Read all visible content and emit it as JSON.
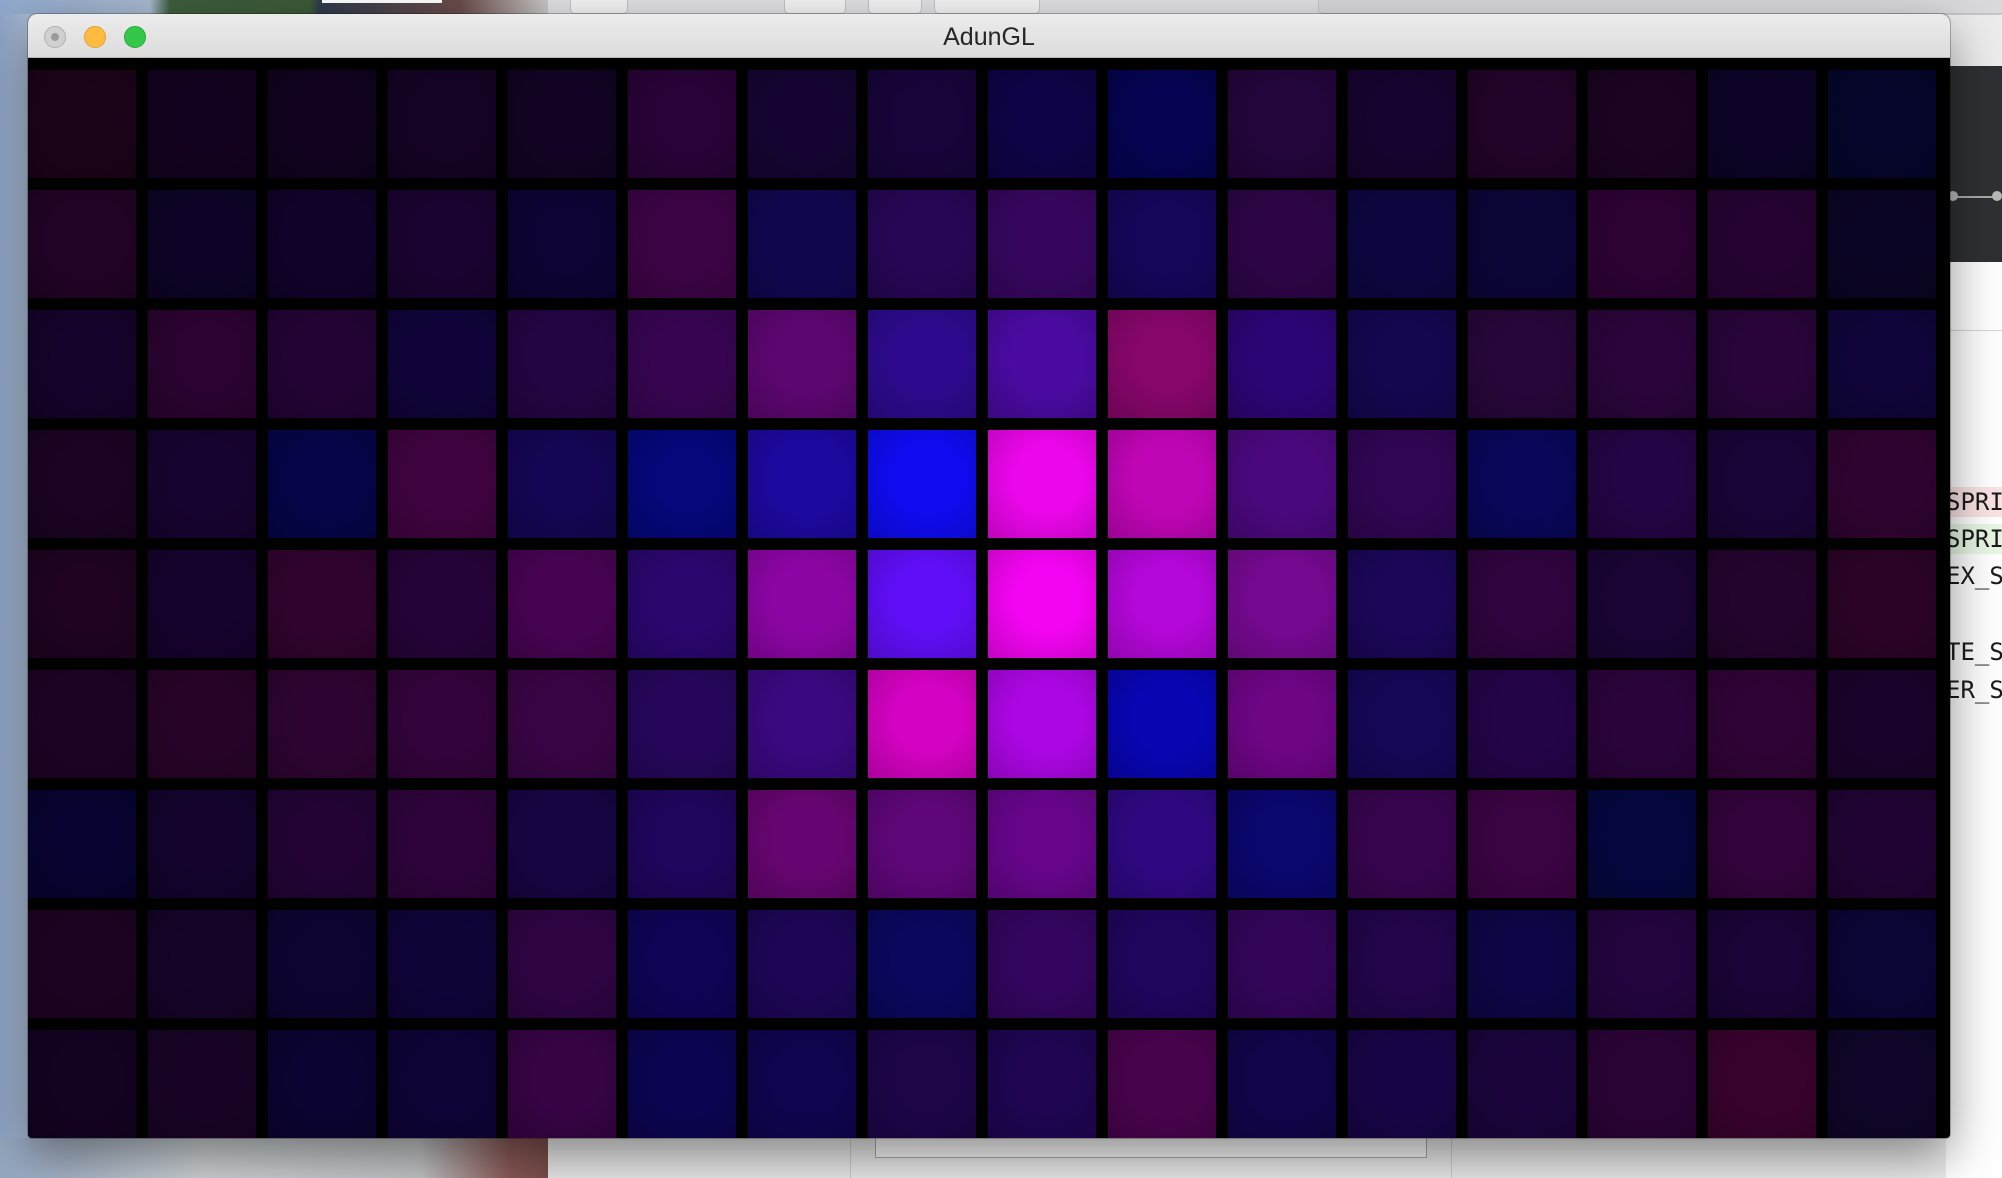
{
  "window": {
    "title": "AdunGL"
  },
  "background_code_fragments": [
    "SPRI",
    "SPRI",
    "EX_S",
    "TE_S",
    "ER_S"
  ],
  "grid": {
    "columns": 16,
    "rows": 9,
    "colors": [
      [
        "#1b0318",
        "#12021f",
        "#10021f",
        "#140325",
        "#120324",
        "#290237",
        "#150432",
        "#17043a",
        "#0e0346",
        "#040351",
        "#23053b",
        "#17032f",
        "#220329",
        "#1b0322",
        "#0d0226",
        "#05052b"
      ],
      [
        "#220326",
        "#0e0326",
        "#11022a",
        "#1a0330",
        "#0d0334",
        "#3c0345",
        "#100650",
        "#260655",
        "#36065f",
        "#170559",
        "#2d0547",
        "#0c0640",
        "#0c0538",
        "#2c0233",
        "#250231",
        "#0a0424"
      ],
      [
        "#14032a",
        "#2a0330",
        "#230334",
        "#11033a",
        "#230543",
        "#370451",
        "#5c0670",
        "#2d0a8d",
        "#4a0aa1",
        "#86066a",
        "#2c0575",
        "#14064f",
        "#270639",
        "#2a043a",
        "#280439",
        "#10043a"
      ],
      [
        "#1b0323",
        "#16032f",
        "#050448",
        "#3f033f",
        "#150554",
        "#05077a",
        "#1c09a0",
        "#0f0bf1",
        "#ec06eb",
        "#c005b6",
        "#4b087e",
        "#300553",
        "#080759",
        "#230444",
        "#190437",
        "#2f0330"
      ],
      [
        "#1f0320",
        "#15022d",
        "#30032f",
        "#250338",
        "#470352",
        "#2a066e",
        "#8c05a5",
        "#600ef7",
        "#f304f2",
        "#b407d9",
        "#760991",
        "#1b0658",
        "#2e043e",
        "#1a0434",
        "#24032d",
        "#2b0327"
      ],
      [
        "#1c0325",
        "#270328",
        "#2d0431",
        "#33033b",
        "#390445",
        "#26065b",
        "#3a0880",
        "#d402c2",
        "#ac06e4",
        "#0805b3",
        "#6d0585",
        "#160656",
        "#230447",
        "#2a033a",
        "#2f0335",
        "#1a032a"
      ],
      [
        "#070330",
        "#13032d",
        "#220334",
        "#2e033b",
        "#170543",
        "#1f055c",
        "#660571",
        "#5e0678",
        "#66058a",
        "#2e0881",
        "#0a076e",
        "#37044e",
        "#3a0342",
        "#04073e",
        "#32033b",
        "#200333"
      ],
      [
        "#1d0322",
        "#150328",
        "#0f0331",
        "#0f0338",
        "#2e0443",
        "#0d0455",
        "#1d0656",
        "#0a075d",
        "#33055f",
        "#20055d",
        "#320559",
        "#22054a",
        "#0c0646",
        "#23043e",
        "#1a0336",
        "#0a0535"
      ],
      [
        "#130222",
        "#180326",
        "#0b0331",
        "#0e0336",
        "#360344",
        "#0b0451",
        "#0f044f",
        "#1d0548",
        "#1f0552",
        "#48034d",
        "#12044a",
        "#170446",
        "#1a043b",
        "#2a0335",
        "#38022e",
        "#100528"
      ]
    ]
  }
}
